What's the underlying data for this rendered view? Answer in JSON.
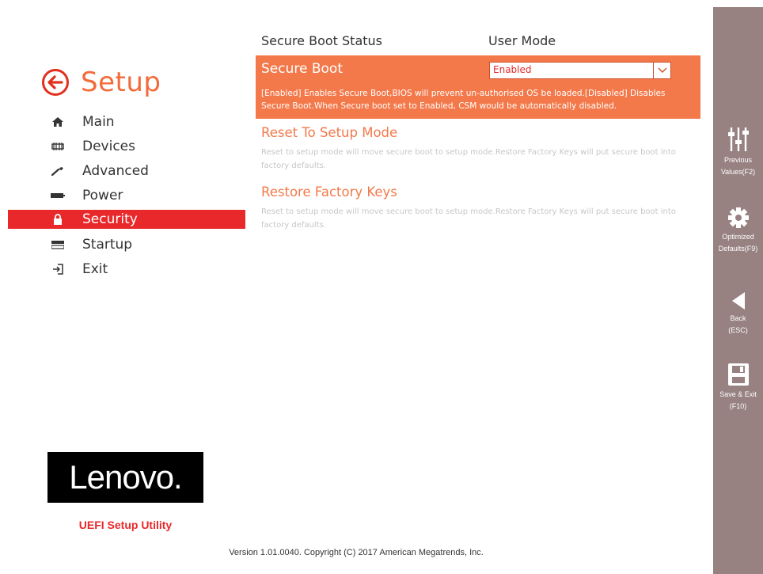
{
  "sidebar": {
    "title": "Setup",
    "items": [
      {
        "label": "Main",
        "icon": "home-icon"
      },
      {
        "label": "Devices",
        "icon": "devices-icon"
      },
      {
        "label": "Advanced",
        "icon": "wrench-icon"
      },
      {
        "label": "Power",
        "icon": "power-icon"
      },
      {
        "label": "Security",
        "icon": "lock-icon",
        "active": true
      },
      {
        "label": "Startup",
        "icon": "startup-icon"
      },
      {
        "label": "Exit",
        "icon": "exit-icon"
      }
    ],
    "logo_text": "Lenovo.",
    "utility_label": "UEFI Setup Utility"
  },
  "main": {
    "status_label": "Secure Boot Status",
    "status_value": "User Mode",
    "secure_boot": {
      "label": "Secure Boot",
      "selected": "Enabled",
      "description": "[Enabled] Enables Secure Boot,BIOS will prevent un-authorised OS be loaded.[Disabled] Disables Secure Boot.When Secure boot set to Enabled, CSM would be automatically disabled."
    },
    "options": [
      {
        "title": "Reset To Setup Mode",
        "description": "Reset to setup mode will move secure boot to setup mode.Restore Factory Keys will put secure boot into factory defaults."
      },
      {
        "title": "Restore Factory Keys",
        "description": "Reset to setup mode will move secure boot to setup mode.Restore Factory Keys will put secure boot into factory defaults."
      }
    ]
  },
  "toolbar": {
    "previous_values": {
      "line1": "Previous",
      "line2": "Values(F2)"
    },
    "optimized_defaults": {
      "line1": "Optimized",
      "line2": "Defaults(F9)"
    },
    "back": {
      "line1": "Back",
      "line2": "(ESC)"
    },
    "save_exit": {
      "line1": "Save & Exit",
      "line2": "(F10)"
    }
  },
  "footer": {
    "version": "Version 1.01.0040. Copyright (C) 2017 American Megatrends, Inc."
  },
  "colors": {
    "accent": "#f3794a",
    "active_nav": "#e8282b",
    "toolbar": "#978181"
  }
}
